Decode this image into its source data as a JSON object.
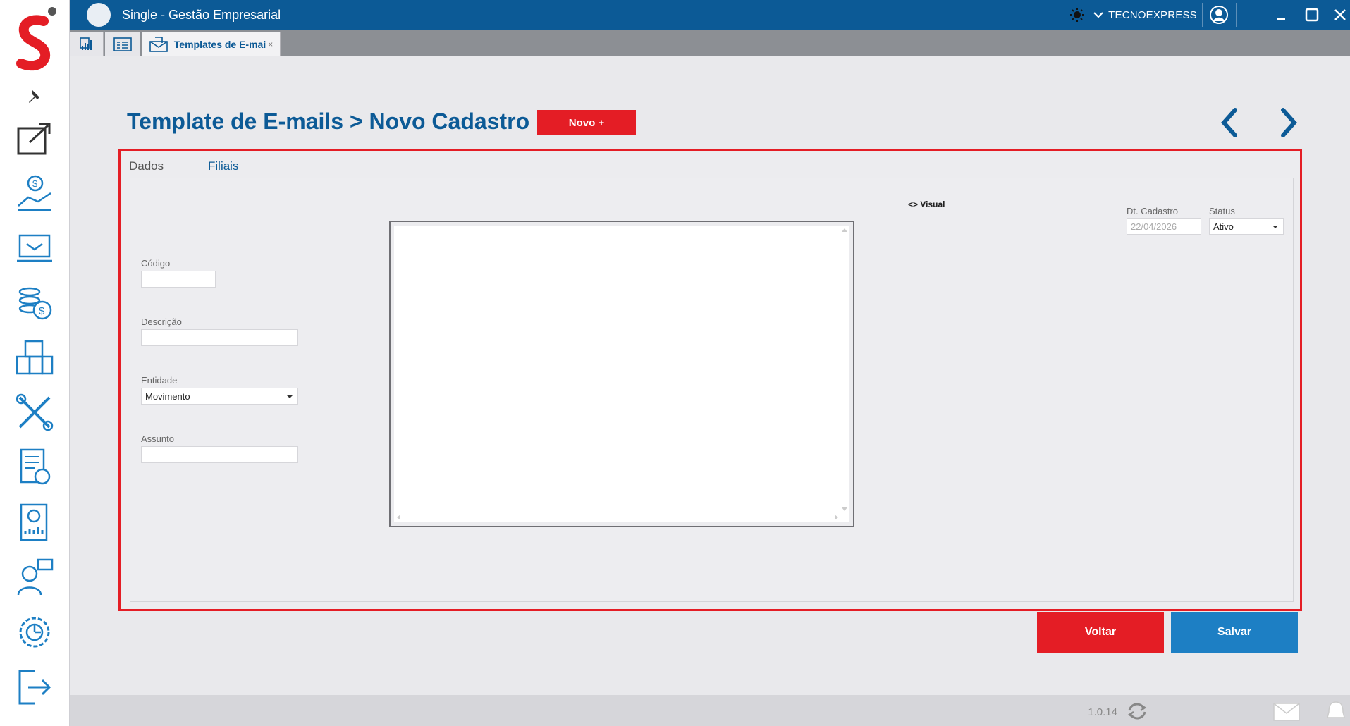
{
  "colors": {
    "brand_blue": "#0c5a96",
    "accent_red": "#e41d25",
    "save_blue": "#1d7fc4",
    "tab_strip": "#8c8f94"
  },
  "sidebar": {
    "logo_icon": "single-s-logo",
    "pin_icon": "pin-icon",
    "items": [
      {
        "icon": "export-icon"
      },
      {
        "icon": "finance-hand-icon"
      },
      {
        "icon": "inbox-laptop-icon"
      },
      {
        "icon": "coins-icon"
      },
      {
        "icon": "warehouse-boxes-icon"
      },
      {
        "icon": "tools-icon"
      },
      {
        "icon": "invoice-icon"
      },
      {
        "icon": "report-chart-icon"
      },
      {
        "icon": "support-agent-icon"
      },
      {
        "icon": "settings-gear-icon"
      },
      {
        "icon": "logout-icon"
      }
    ]
  },
  "titlebar": {
    "app_title": "Single - Gestão Empresarial",
    "company": "TECNOEXPRESS"
  },
  "tabs": [
    {
      "icon": "dashboard-tab-icon",
      "label": ""
    },
    {
      "icon": "form-tab-icon",
      "label": ""
    },
    {
      "icon": "email-template-tab-icon",
      "label": "Templates de E-mai",
      "close": "×"
    }
  ],
  "header": {
    "title": "Template de E-mails > Novo Cadastro",
    "novo_button": "Novo +"
  },
  "form": {
    "subtabs": {
      "dados": "Dados",
      "filiais": "Filiais"
    },
    "codigo": {
      "label": "Código",
      "value": ""
    },
    "descricao": {
      "label": "Descrição",
      "value": ""
    },
    "entidade": {
      "label": "Entidade",
      "value": "Movimento"
    },
    "assunto": {
      "label": "Assunto",
      "value": ""
    },
    "visual_toggle": "<> Visual",
    "dt_cadastro": {
      "label": "Dt. Cadastro",
      "value": "22/04/2026"
    },
    "status": {
      "label": "Status",
      "value": "Ativo"
    }
  },
  "footer": {
    "voltar": "Voltar",
    "salvar": "Salvar"
  },
  "statusbar": {
    "version": "1.0.14"
  }
}
